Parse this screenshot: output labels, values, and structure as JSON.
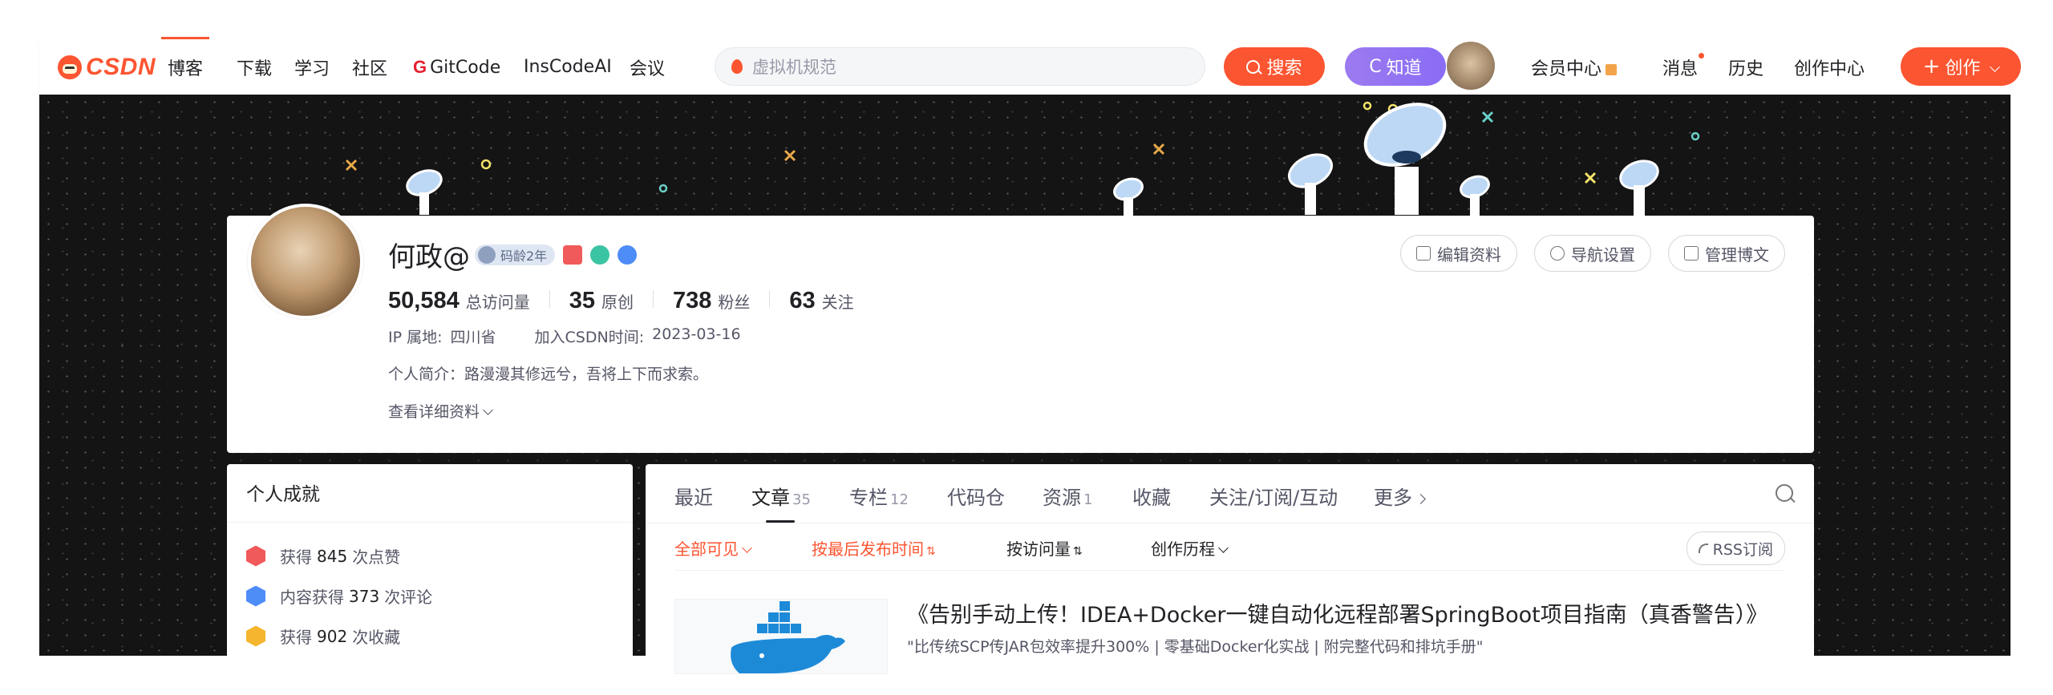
{
  "brand": {
    "logo_text": "CSDN",
    "accent": "#fc5531"
  },
  "nav": {
    "items": [
      "博客",
      "下载",
      "学习",
      "社区",
      "GitCode",
      "InsCodeAI",
      "会议"
    ],
    "active": "博客"
  },
  "search": {
    "placeholder": "虚拟机规范",
    "search_button": "搜索",
    "zhidao_button": "知道",
    "zhidao_prefix": "C"
  },
  "right_nav": {
    "vip": "会员中心",
    "messages": "消息",
    "history": "历史",
    "creator_center": "创作中心",
    "create_button": "创作"
  },
  "profile": {
    "name": "何政@",
    "code_age_badge": "码龄2年",
    "stats": [
      {
        "value": "50,584",
        "label": "总访问量"
      },
      {
        "value": "35",
        "label": "原创"
      },
      {
        "value": "738",
        "label": "粉丝"
      },
      {
        "value": "63",
        "label": "关注"
      }
    ],
    "ip_label": "IP 属地:",
    "ip_value": "四川省",
    "join_label": "加入CSDN时间:",
    "join_value": "2023-03-16",
    "bio": "个人简介：路漫漫其修远兮，吾将上下而求索。",
    "more_link": "查看详细资料",
    "buttons": {
      "edit": "编辑资料",
      "nav_settings": "导航设置",
      "manage": "管理博文"
    }
  },
  "achievements": {
    "title": "个人成就",
    "items": [
      {
        "prefix": "获得",
        "value": "845",
        "suffix": "次点赞",
        "color": "#f05a5a"
      },
      {
        "prefix": "内容获得",
        "value": "373",
        "suffix": "次评论",
        "color": "#4e8cf7"
      },
      {
        "prefix": "获得",
        "value": "902",
        "suffix": "次收藏",
        "color": "#f5b52e"
      }
    ]
  },
  "tabs": [
    {
      "label": "最近",
      "count": ""
    },
    {
      "label": "文章",
      "count": "35"
    },
    {
      "label": "专栏",
      "count": "12"
    },
    {
      "label": "代码仓",
      "count": ""
    },
    {
      "label": "资源",
      "count": "1"
    },
    {
      "label": "收藏",
      "count": ""
    },
    {
      "label": "关注/订阅/互动",
      "count": ""
    },
    {
      "label": "更多",
      "count": ""
    }
  ],
  "filters": {
    "visibility": "全部可见",
    "sort_time": "按最后发布时间",
    "sort_views": "按访问量",
    "history": "创作历程",
    "rss": "RSS订阅"
  },
  "article": {
    "title": "《告别手动上传！IDEA+Docker一键自动化远程部署SpringBoot项目指南（真香警告）》",
    "desc": "\"比传统SCP传JAR包效率提升300% | 零基础Docker化实战 | 附完整代码和排坑手册\""
  }
}
